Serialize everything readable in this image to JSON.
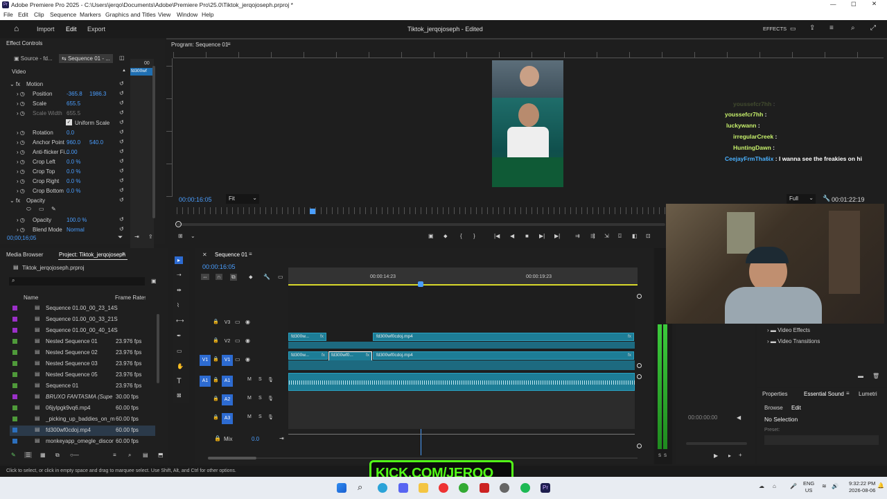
{
  "window": {
    "title": "Adobe Premiere Pro 2025 - C:\\Users\\jerqo\\Documents\\Adobe\\Premiere Pro\\25.0\\Tiktok_jerqojoseph.prproj *"
  },
  "menu": [
    "File",
    "Edit",
    "Clip",
    "Sequence",
    "Markers",
    "Graphics and Titles",
    "View",
    "Window",
    "Help"
  ],
  "topnav": {
    "import": "Import",
    "edit": "Edit",
    "export": "Export",
    "project_title": "Tiktok_jerqojoseph - Edited",
    "effects": "EFFECTS"
  },
  "effect_controls": {
    "title": "Effect Controls",
    "source_tab": "Source - fd...",
    "seq_tab": "Sequence 01 - ...",
    "video_label": "Video",
    "clip_label": "fd300wf",
    "zoom_readout": "00",
    "rows": [
      {
        "name": "Motion",
        "v1": "",
        "v2": ""
      },
      {
        "name": "Position",
        "v1": "-365.8",
        "v2": "1986.3"
      },
      {
        "name": "Scale",
        "v1": "655.5",
        "v2": ""
      },
      {
        "name": "Scale Width",
        "v1": "655.5",
        "v2": ""
      },
      {
        "name": "Uniform Scale",
        "v1": "",
        "v2": ""
      },
      {
        "name": "Rotation",
        "v1": "0.0",
        "v2": ""
      },
      {
        "name": "Anchor Point",
        "v1": "960.0",
        "v2": "540.0"
      },
      {
        "name": "Anti-flicker Fi...",
        "v1": "0.00",
        "v2": ""
      },
      {
        "name": "Crop Left",
        "v1": "0.0 %",
        "v2": ""
      },
      {
        "name": "Crop Top",
        "v1": "0.0 %",
        "v2": ""
      },
      {
        "name": "Crop Right",
        "v1": "0.0 %",
        "v2": ""
      },
      {
        "name": "Crop Bottom",
        "v1": "0.0 %",
        "v2": ""
      },
      {
        "name": "Opacity",
        "v1": "",
        "v2": ""
      },
      {
        "name": "Opacity",
        "v1": "100.0 %",
        "v2": ""
      },
      {
        "name": "Blend Mode",
        "v1": "Normal",
        "v2": ""
      }
    ],
    "timecode": "00;00;16;05"
  },
  "program": {
    "title": "Program: Sequence 01",
    "timecode": "00:00:16:05",
    "fit": "Fit",
    "full": "Full",
    "duration": "00:01:22:19",
    "chat": [
      {
        "user": "youssefcr7hh",
        "msg": ":"
      },
      {
        "user": "youssefcr7hh",
        "msg": ":"
      },
      {
        "user": "luckywann",
        "msg": ":"
      },
      {
        "user": "irregularCreek",
        "msg": ":"
      },
      {
        "user": "HuntingDawn",
        "msg": ":"
      },
      {
        "user": "CeejayFrmTha6ix",
        "msg": ": I wanna see the freakies on hi"
      }
    ]
  },
  "project": {
    "tab_media": "Media Browser",
    "tab_project": "Project: Tiktok_jerqojoseph",
    "file": "Tiktok_jerqojoseph.prproj",
    "col_name": "Name",
    "col_rate": "Frame Rate",
    "items": [
      {
        "name": "Sequence 01.00_00_23_14S",
        "rate": "",
        "color": "#9b30c8"
      },
      {
        "name": "Sequence 01.00_00_33_21S",
        "rate": "",
        "color": "#9b30c8"
      },
      {
        "name": "Sequence 01.00_00_40_14S",
        "rate": "",
        "color": "#9b30c8"
      },
      {
        "name": "Nested Sequence 01",
        "rate": "23.976 fps",
        "color": "#4f9a3a"
      },
      {
        "name": "Nested Sequence 02",
        "rate": "23.976 fps",
        "color": "#4f9a3a"
      },
      {
        "name": "Nested Sequence 03",
        "rate": "23.976 fps",
        "color": "#4f9a3a"
      },
      {
        "name": "Nested Sequence 05",
        "rate": "23.976 fps",
        "color": "#4f9a3a"
      },
      {
        "name": "Sequence 01",
        "rate": "23.976 fps",
        "color": "#4f9a3a"
      },
      {
        "name": "BRUXO FANTASMA (Supe",
        "rate": "30.00 fps",
        "color": "#9b30c8"
      },
      {
        "name": "06jylpgk9vq6.mp4",
        "rate": "60.00 fps",
        "color": "#4f9a3a"
      },
      {
        "name": "_picking_up_baddies_on_m",
        "rate": "60.00 fps",
        "color": "#4f9a3a"
      },
      {
        "name": "fd300wf0cdoj.mp4",
        "rate": "60.00 fps",
        "color": "#2c6fbd"
      },
      {
        "name": "monkeyapp_omegle_discor",
        "rate": "60.00 fps",
        "color": "#2c6fbd"
      }
    ]
  },
  "timeline": {
    "title": "Sequence 01",
    "timecode": "00:00:16:05",
    "ruler": [
      "00:00:14:23",
      "00:00:19:23"
    ],
    "tracks": [
      "V3",
      "V2",
      "V1",
      "A1",
      "A2",
      "A3"
    ],
    "mix_label": "Mix",
    "mix_val": "0.0",
    "clip_v2a": "fd300w...",
    "clip_v2b": "fd300wf0cdoj.mp4",
    "clip_v1a": "fd300w...",
    "clip_v1b": "fd300wf0...",
    "clip_v1c": "fd300wf0cdoj.mp4"
  },
  "right": {
    "video_effects": "Video Effects",
    "video_transitions": "Video Transitions",
    "tab_properties": "Properties",
    "tab_sound": "Essential Sound",
    "tab_lumetri": "Lumetri",
    "browse": "Browse",
    "edit": "Edit",
    "no_selection": "No Selection",
    "preset": "Preset:",
    "tc": "00:00:00:00"
  },
  "status": "Click to select, or click in empty space and drag to marquee select. Use Shift, Alt, and Ctrl for other options.",
  "overlay_text": "KICK.COM/JERQO",
  "taskbar": {
    "lang1": "ENG",
    "lang2": "US",
    "time": "9:32:22 PM",
    "date": "2026-08-06"
  }
}
